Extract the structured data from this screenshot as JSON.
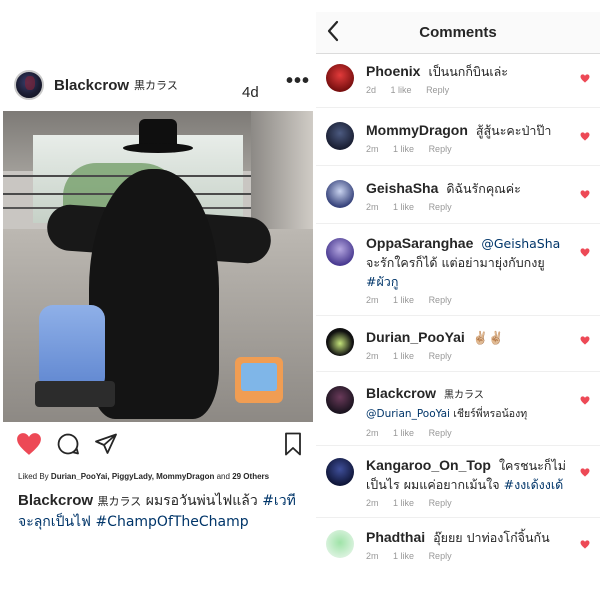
{
  "post": {
    "username": "Blackcrow",
    "username_sub": "黒カラス",
    "time": "4d",
    "more_label": "•••",
    "likes": {
      "prefix": "Liked By",
      "names": "Durian_PooYai, PiggyLady, MommyDragon",
      "and": "and",
      "others": "29 Others"
    },
    "caption": {
      "username": "Blackcrow",
      "username_sub": "黒カラス",
      "text": "ผมรอวันพ่นไฟแล้ว",
      "tag1": "#เวทีจะลุกเป็นไฟ",
      "tag2": "#ChampOfTheChamp"
    },
    "icons": {
      "like": "heart-icon",
      "comment": "comment-icon",
      "share": "send-icon",
      "save": "bookmark-icon"
    },
    "colors": {
      "like_active": "#ed4956",
      "hashtag": "#003569",
      "meta": "#999999"
    }
  },
  "comments_panel": {
    "title": "Comments",
    "back_icon": "chevron-left-icon",
    "items": [
      {
        "user": "Phoenix",
        "user_sub": "",
        "mention": "",
        "text": "เป็นนกก็บินเล่ะ",
        "tag": "",
        "time": "2d",
        "likes": "1 like",
        "reply": "Reply"
      },
      {
        "user": "MommyDragon",
        "user_sub": "",
        "mention": "",
        "text": "สู้สู้นะคะป่าป๊า",
        "tag": "",
        "time": "2m",
        "likes": "1 like",
        "reply": "Reply"
      },
      {
        "user": "GeishaSha",
        "user_sub": "",
        "mention": "",
        "text": "ดิฉันรักคุณค่ะ",
        "tag": "",
        "time": "2m",
        "likes": "1 like",
        "reply": "Reply"
      },
      {
        "user": "OppaSaranghae",
        "user_sub": "",
        "mention": "@GeishaSha",
        "text": "จะรักใครก็ได้ แต่อย่ามายุ่งกับกงยู",
        "tag": "#ผัวกู",
        "time": "2m",
        "likes": "1 like",
        "reply": "Reply"
      },
      {
        "user": "Durian_PooYai",
        "user_sub": "",
        "mention": "",
        "text": "✌🏼✌🏼",
        "tag": "",
        "time": "2m",
        "likes": "1 like",
        "reply": "Reply"
      },
      {
        "user": "Blackcrow",
        "user_sub": "黒カラス",
        "mention": "@Durian_PooYai",
        "text": "เชียร์พี่หรอน้องทุ",
        "tag": "",
        "time": "2m",
        "likes": "1 like",
        "reply": "Reply"
      },
      {
        "user": "Kangaroo_On_Top",
        "user_sub": "",
        "mention": "",
        "text": "ใครชนะก็ไม่เป็นไร ผมแค่อยากเม้นใจ",
        "tag": "#งงเด้งงเด้",
        "time": "2m",
        "likes": "1 like",
        "reply": "Reply"
      },
      {
        "user": "Phadthai",
        "user_sub": "",
        "mention": "",
        "text": "อุ๊ยยย ปาท่องโก๋จิ้นกัน",
        "tag": "",
        "time": "2m",
        "likes": "1 like",
        "reply": "Reply"
      }
    ]
  }
}
